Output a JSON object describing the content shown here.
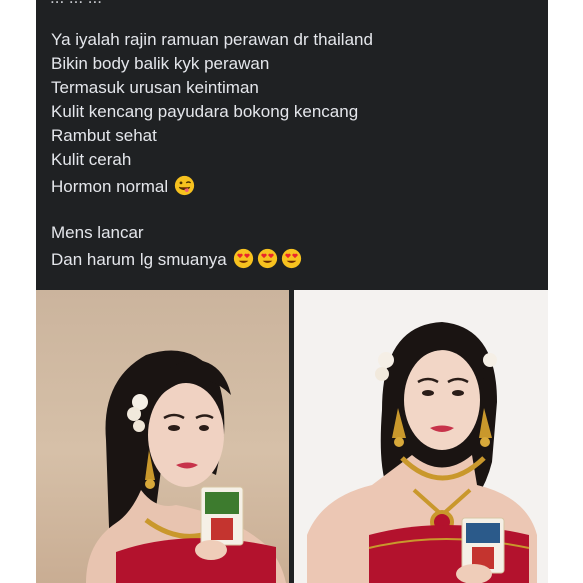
{
  "post": {
    "cut_line": "... ... ...",
    "lines": [
      "Ya iyalah rajin ramuan perawan dr thailand",
      "Bikin body balik kyk perawan",
      "Termasuk urusan keintiman",
      "Kulit kencang payudara bokong kencang",
      "Rambut sehat",
      "Kulit cerah",
      "Hormon normal",
      "Mens lancar",
      "Dan harum lg smuanya"
    ],
    "emoji": {
      "hormon_line": "winking-face-with-tongue-icon",
      "harum_line": [
        "heart-eyes-icon",
        "heart-eyes-icon",
        "heart-eyes-icon"
      ]
    }
  },
  "photos": {
    "left": {
      "subject": "woman-in-thai-costume-holding-product",
      "background_color": "#cfb79f"
    },
    "right": {
      "subject": "woman-in-thai-costume-holding-product",
      "background_color": "#f4f2f0"
    }
  },
  "colors": {
    "post_background": "#1f2123",
    "post_text": "#e4e6eb",
    "emoji_yellow": "#f7c21f",
    "emoji_heart": "#e8262c",
    "costume_red": "#b3122d",
    "gold": "#c9982c"
  }
}
